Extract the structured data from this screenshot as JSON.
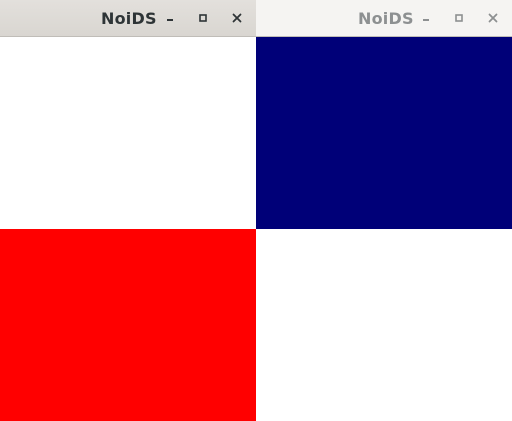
{
  "windows": [
    {
      "title": "NoiDS",
      "state": "focused",
      "title_color": "#2e3436",
      "content": {
        "top_color": "#ffffff",
        "bottom_color": "#ff0000"
      }
    },
    {
      "title": "NoiDS",
      "state": "unfocused",
      "title_color": "#8d9091",
      "content": {
        "top_color": "#000078",
        "bottom_color": "#ffffff"
      }
    }
  ],
  "controls": {
    "minimize_icon": "minimize-icon",
    "maximize_icon": "maximize-icon",
    "close_icon": "close-icon"
  }
}
